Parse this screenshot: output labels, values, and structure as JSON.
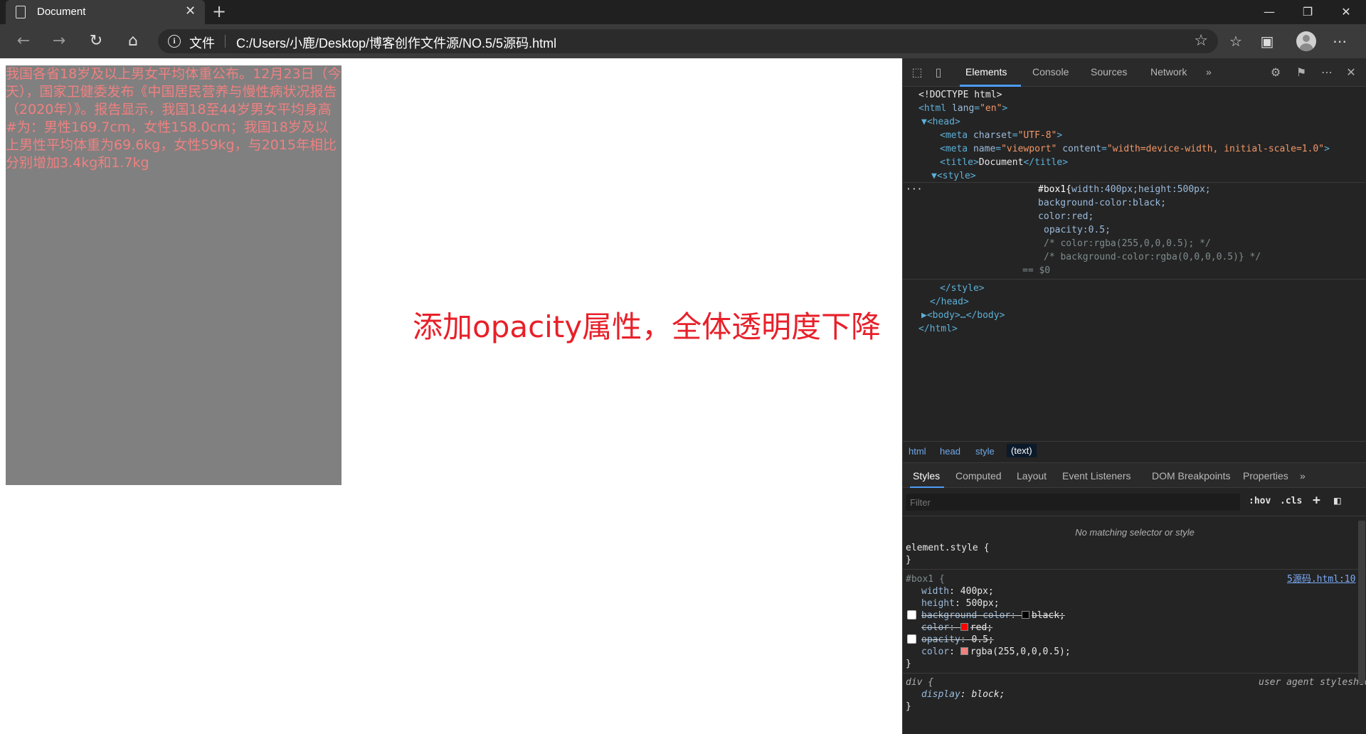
{
  "browser": {
    "tab_title": "Document",
    "tab_close": "✕",
    "new_tab": "+",
    "window_controls": {
      "minimize": "—",
      "restore": "❐",
      "close": "✕"
    },
    "address": {
      "info_icon": "i",
      "scheme_label": "文件",
      "url": "C:/Users/小鹿/Desktop/博客创作文件源/NO.5/5源码.html"
    },
    "nav": {
      "back": "←",
      "forward": "→",
      "refresh": "↻",
      "home": "⌂"
    },
    "toolbar": {
      "favorite": "☆",
      "favorites": "☆",
      "collections": "▣",
      "more": "⋯"
    }
  },
  "page": {
    "box_text": "我国各省18岁及以上男女平均体重公布。12月23日（今天），国家卫健委发布《中国居民营养与慢性病状况报告（2020年）》。报告显示，我国18至44岁男女平均身高#为：男性169.7cm，女性158.0cm；我国18岁及以上男性平均体重为69.6kg，女性59kg，与2015年相比分别增加3.4kg和1.7kg",
    "annotation": "添加opacity属性，全体透明度下降",
    "colors": {
      "box_bg": "#808080",
      "box_text": "#f08080",
      "annotation": "#e8202a"
    }
  },
  "devtools": {
    "tabs": [
      "Elements",
      "Console",
      "Sources",
      "Network"
    ],
    "more_tabs": "»",
    "settings_icon": "⚙",
    "feedback_icon": "⚑",
    "menu_icon": "⋯",
    "close_icon": "✕",
    "dom": {
      "doctype": "<!DOCTYPE html>",
      "html_open_tag": "<html",
      "html_attr": "lang",
      "html_attr_val": "\"en\"",
      "head_open": "▼<head>",
      "meta1_tag": "<meta",
      "meta1_attr": "charset",
      "meta1_val": "\"UTF-8\"",
      "meta2_tag": "<meta",
      "meta2_attr_name": "name",
      "meta2_val_name": "\"viewport\"",
      "meta2_attr_content": "content",
      "meta2_val_content": "\"width=device-width, initial-scale=1.0\"",
      "title_open": "<title>",
      "title_text": "Document",
      "title_close": "</title>",
      "style_open": "▼<style>",
      "ellipsis": "···",
      "css_line1_sel": "#box1{",
      "css_line1_rest": "width:400px;height:500px;",
      "css_line2": "background-color:black;",
      "css_line3": "color:red;",
      "css_line4": "opacity:0.5;",
      "css_line5": "/* color:rgba(255,0,0,0.5); */",
      "css_line6": "/* background-color:rgba(0,0,0,0.5)} */",
      "dollar0": "== $0",
      "style_close": "</style>",
      "head_close": "</head>",
      "body_collapsed": "▶<body>…</body>",
      "html_close": "</html>"
    },
    "breadcrumb": [
      "html",
      "head",
      "style",
      "(text)"
    ],
    "subtabs": [
      "Styles",
      "Computed",
      "Layout",
      "Event Listeners",
      "DOM Breakpoints",
      "Properties"
    ],
    "subtabs_more": "»",
    "filter_placeholder": "Filter",
    "filter_buttons": {
      "hov": ":hov",
      "cls": ".cls",
      "add": "+",
      "toggle": "◧"
    },
    "styles": {
      "no_match": "No matching selector or style",
      "element_style_open": "element.style {",
      "close_brace": "}",
      "rule_selector": "#box1 {",
      "rule_source": "5源码.html:10",
      "decl_width_prop": "width",
      "decl_width_val": "400px;",
      "decl_height_prop": "height",
      "decl_height_val": "500px;",
      "decl_bg_prop": "background-color:",
      "decl_bg_val": "black;",
      "decl_color1_prop": "color:",
      "decl_color1_val": "red;",
      "decl_opacity_prop": "opacity:",
      "decl_opacity_val": "0.5;",
      "decl_color2_prop": "color",
      "decl_color2_val": "rgba(255,0,0,0.5);",
      "ua_selector": "div {",
      "ua_source": "user agent stylesheet",
      "ua_prop": "display",
      "ua_val": "block;"
    }
  }
}
